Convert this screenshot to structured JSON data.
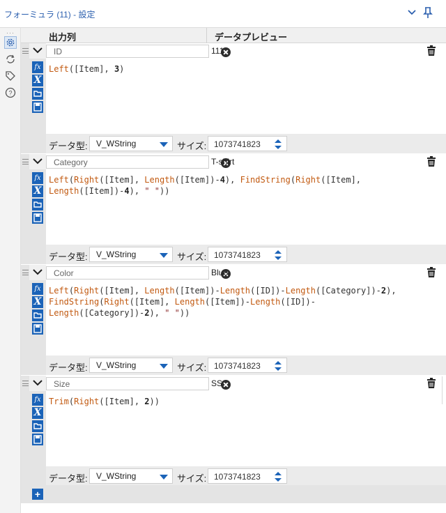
{
  "window": {
    "title": "フォーミュラ (11) - 設定"
  },
  "header": {
    "output_column": "出力列",
    "data_preview": "データプレビュー"
  },
  "footer_labels": {
    "data_type": "データ型:",
    "size": "サイズ:"
  },
  "formulas": [
    {
      "name": "ID",
      "preview": "111",
      "type": "V_WString",
      "size": "1073741823",
      "expression": [
        [
          [
            "k",
            "Left"
          ],
          [
            "p",
            "([Item], "
          ],
          [
            "n",
            "3"
          ],
          [
            "p",
            ")"
          ]
        ]
      ]
    },
    {
      "name": "Category",
      "preview": "T-shirt",
      "type": "V_WString",
      "size": "1073741823",
      "expression": [
        [
          [
            "k",
            "Left"
          ],
          [
            "p",
            "("
          ],
          [
            "k",
            "Right"
          ],
          [
            "p",
            "([Item], "
          ],
          [
            "k",
            "Length"
          ],
          [
            "p",
            "([Item])-"
          ],
          [
            "n",
            "4"
          ],
          [
            "p",
            "), "
          ],
          [
            "k",
            "FindString"
          ],
          [
            "p",
            "("
          ],
          [
            "k",
            "Right"
          ],
          [
            "p",
            "([Item],"
          ]
        ],
        [
          [
            "k",
            "Length"
          ],
          [
            "p",
            "([Item])-"
          ],
          [
            "n",
            "4"
          ],
          [
            "p",
            "), "
          ],
          [
            "s",
            "\" \""
          ],
          [
            "p",
            "))"
          ]
        ]
      ]
    },
    {
      "name": "Color",
      "preview": "Blue",
      "type": "V_WString",
      "size": "1073741823",
      "expression": [
        [
          [
            "k",
            "Left"
          ],
          [
            "p",
            "("
          ],
          [
            "k",
            "Right"
          ],
          [
            "p",
            "([Item], "
          ],
          [
            "k",
            "Length"
          ],
          [
            "p",
            "([Item])-"
          ],
          [
            "k",
            "Length"
          ],
          [
            "p",
            "([ID])-"
          ],
          [
            "k",
            "Length"
          ],
          [
            "p",
            "([Category])-"
          ],
          [
            "n",
            "2"
          ],
          [
            "p",
            "),"
          ]
        ],
        [
          [
            "k",
            "FindString"
          ],
          [
            "p",
            "("
          ],
          [
            "k",
            "Right"
          ],
          [
            "p",
            "([Item], "
          ],
          [
            "k",
            "Length"
          ],
          [
            "p",
            "([Item])-"
          ],
          [
            "k",
            "Length"
          ],
          [
            "p",
            "([ID])-"
          ]
        ],
        [
          [
            "k",
            "Length"
          ],
          [
            "p",
            "([Category])-"
          ],
          [
            "n",
            "2"
          ],
          [
            "p",
            "), "
          ],
          [
            "s",
            "\" \""
          ],
          [
            "p",
            "))"
          ]
        ]
      ]
    },
    {
      "name": "Size",
      "preview": "SS",
      "type": "V_WString",
      "size": "1073741823",
      "expression": [
        [
          [
            "k",
            "Trim"
          ],
          [
            "p",
            "("
          ],
          [
            "k",
            "Right"
          ],
          [
            "p",
            "([Item], "
          ],
          [
            "n",
            "2"
          ],
          [
            "p",
            "))"
          ]
        ]
      ]
    }
  ],
  "colors": {
    "accent": "#1b63b8",
    "title": "#2b5fae",
    "function": "#c25a11"
  },
  "icons": {
    "sidebar": [
      "gear-icon",
      "refresh-icon",
      "tag-icon",
      "help-icon"
    ],
    "tools": [
      "fx-icon",
      "variable-icon",
      "folder-icon",
      "save-icon"
    ],
    "row": [
      "grip-icon",
      "chevron-down-icon",
      "clear-icon",
      "trash-icon"
    ],
    "add": "add-icon"
  }
}
